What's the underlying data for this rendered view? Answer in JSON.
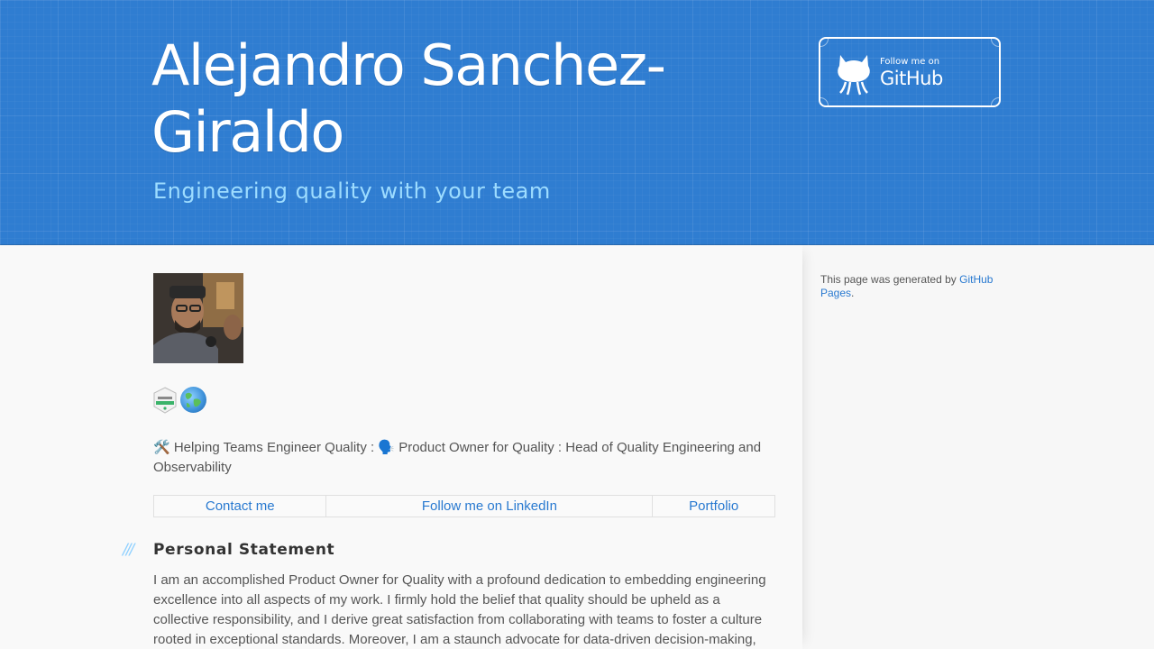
{
  "header": {
    "title": "Alejandro Sanchez-Giraldo",
    "tagline": "Engineering quality with your team",
    "github_button": {
      "follow_text": "Follow me on",
      "name": "GitHub"
    }
  },
  "profile": {
    "avatar_alt": "Profile photo",
    "intro_text": "🛠️ Helping Teams Engineer Quality : 🗣️ Product Owner for Quality : Head of Quality Engineering and Observability"
  },
  "links": [
    {
      "label": "Contact me"
    },
    {
      "label": "Follow me on LinkedIn"
    },
    {
      "label": "Portfolio"
    }
  ],
  "section": {
    "slashes": "///",
    "title": "Personal Statement",
    "body": "I am an accomplished Product Owner for Quality with a profound dedication to embedding engineering excellence into all aspects of my work. I firmly hold the belief that quality should be upheld as a collective responsibility, and I derive great satisfaction from collaborating with teams to foster a culture rooted in exceptional standards. Moreover, I am a staunch advocate for data-driven decision-making,"
  },
  "sidebar": {
    "generated_prefix": "This page was generated by ",
    "generated_link": "GitHub Pages",
    "generated_suffix": "."
  },
  "colors": {
    "header_bg": "#2f7dd1",
    "tagline": "#9ddcff",
    "link": "#2879d0"
  }
}
